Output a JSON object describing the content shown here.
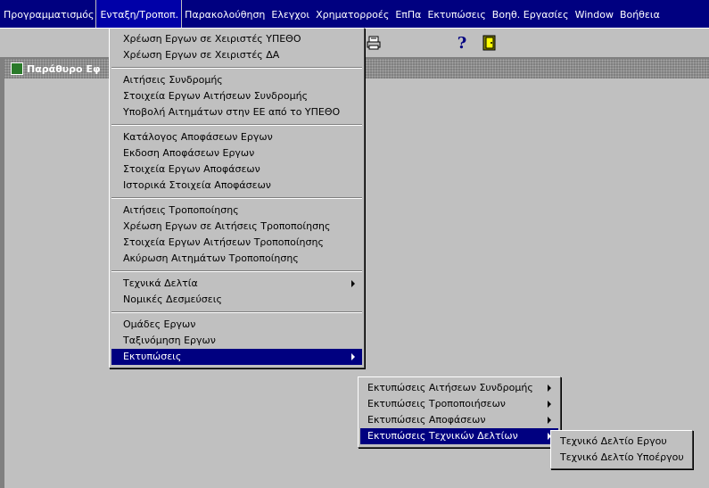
{
  "menubar": [
    "Προγραμματισμός",
    "Ενταξη/Τροποπ.",
    "Παρακολούθηση",
    "Ελεγχοι",
    "Χρηματορροές",
    "ΕπΠα",
    "Εκτυπώσεις",
    "Βοηθ. Εργασίες",
    "Window",
    "Βοήθεια"
  ],
  "active_menu_index": 1,
  "window_title": "Παράθυρο Εφ",
  "toolbar_icons": [
    "printer-icon",
    "help-icon",
    "exit-door-icon"
  ],
  "toolbar_help_glyph": "?",
  "main_menu": {
    "groups": [
      [
        "Χρέωση Εργων σε Χειριστές ΥΠΕΘΟ",
        "Χρέωση Εργων σε Χειριστές ΔΑ"
      ],
      [
        "Αιτήσεις Συνδρομής",
        "Στοιχεία Εργων Αιτήσεων Συνδρομής",
        "Υποβολή Αιτημάτων στην ΕΕ από το ΥΠΕΘΟ"
      ],
      [
        "Κατάλογος Αποφάσεων Εργων",
        "Εκδοση Αποφάσεων Εργων",
        "Στοιχεία Εργων Αποφάσεων",
        "Ιστορικά Στοιχεία Αποφάσεων"
      ],
      [
        "Αιτήσεις Τροποποίησης",
        "Χρέωση Εργων σε Αιτήσεις Τροποποίησης",
        "Στοιχεία Εργων Αιτήσεων Τροποποίησης",
        "Ακύρωση Αιτημάτων Τροποποίησης"
      ],
      [
        "Τεχνικά Δελτία",
        "Νομικές Δεσμεύσεις"
      ],
      [
        "Ομάδες Εργων",
        "Ταξινόμηση Εργων",
        "Εκτυπώσεις"
      ]
    ],
    "submenu_items": [
      "Τεχνικά Δελτία",
      "Εκτυπώσεις"
    ],
    "selected": "Εκτυπώσεις"
  },
  "sub_menu_prints": {
    "items": [
      "Εκτυπώσεις Αιτήσεων Συνδρομής",
      "Εκτυπώσεις Τροποποιήσεων",
      "Εκτυπώσεις Αποφάσεων",
      "Εκτυπώσεις Τεχνικών Δελτίων"
    ],
    "selected": "Εκτυπώσεις Τεχνικών Δελτίων"
  },
  "sub_menu_tech": {
    "items": [
      "Τεχνικό Δελτίο Εργου",
      "Τεχνικό Δελτίο Υποέργου"
    ]
  }
}
